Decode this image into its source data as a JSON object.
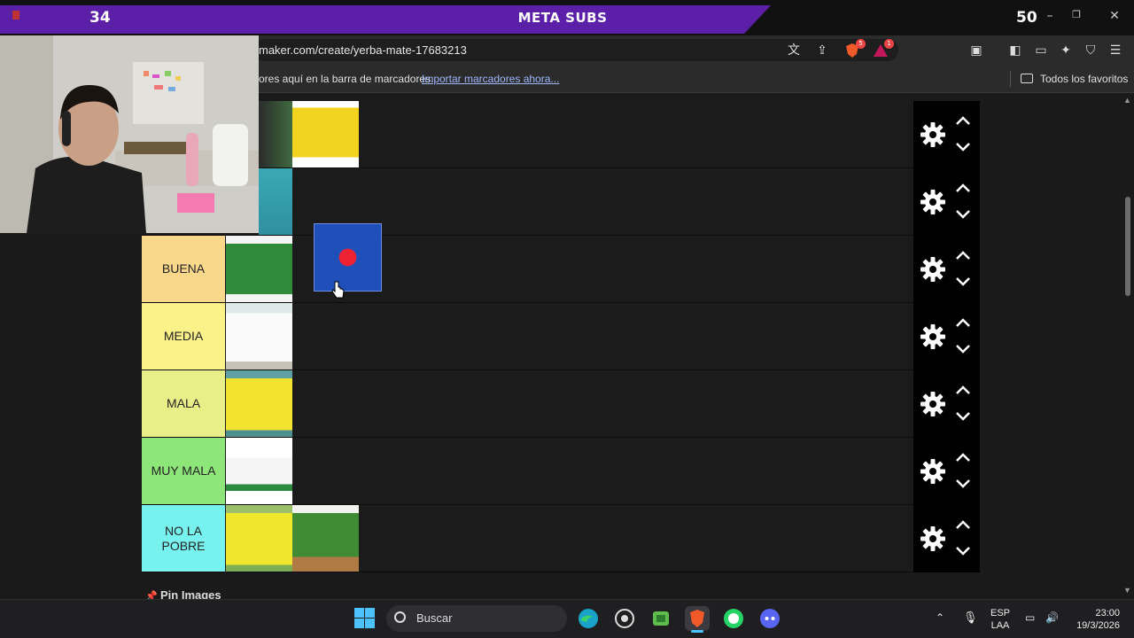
{
  "stream": {
    "left_count": "34",
    "title": "META SUBS",
    "right_count": "50"
  },
  "browser": {
    "url": "maker.com/create/yerba-mate-17683213",
    "bookmarks_message": "ores aquí en la barra de marcadores.",
    "bookmarks_import_link": "Importar marcadores ahora...",
    "all_bookmarks": "Todos los favoritos",
    "shield_badge": "5",
    "alert_badge": "1"
  },
  "tiers": [
    {
      "label": "",
      "color": "#1b1b1b",
      "items": [
        "pindare-pack"
      ]
    },
    {
      "label": "",
      "color": "#1b1b1b",
      "items": []
    },
    {
      "label": "BUENA",
      "color": "#f9d88c",
      "items": [
        "green-pack",
        "sara-pack-dragging"
      ]
    },
    {
      "label": "MEDIA",
      "color": "#fbf38a",
      "items": [
        "white-pack"
      ]
    },
    {
      "label": "MALA",
      "color": "#e9ef88",
      "items": [
        "canarias-yellow-pack"
      ]
    },
    {
      "label": "MUY MALA",
      "color": "#8ee67a",
      "items": [
        "canarias-white-pack"
      ]
    },
    {
      "label": "NO LA POBRE",
      "color": "#78f2ee",
      "items": [
        "export-pack",
        "green-mate-pack"
      ]
    }
  ],
  "pin_images_label": "Pin Images",
  "taskbar": {
    "search_placeholder": "Buscar",
    "lang_top": "ESP",
    "lang_bottom": "LAA",
    "time": "23:00",
    "date": "19/3/2026"
  },
  "colors": {
    "stream_purple": "#5b1fa8",
    "buena": "#f9d88c",
    "media": "#fbf38a",
    "mala": "#e9ef88",
    "muy_mala": "#8ee67a",
    "no_la_pobre": "#78f2ee"
  }
}
